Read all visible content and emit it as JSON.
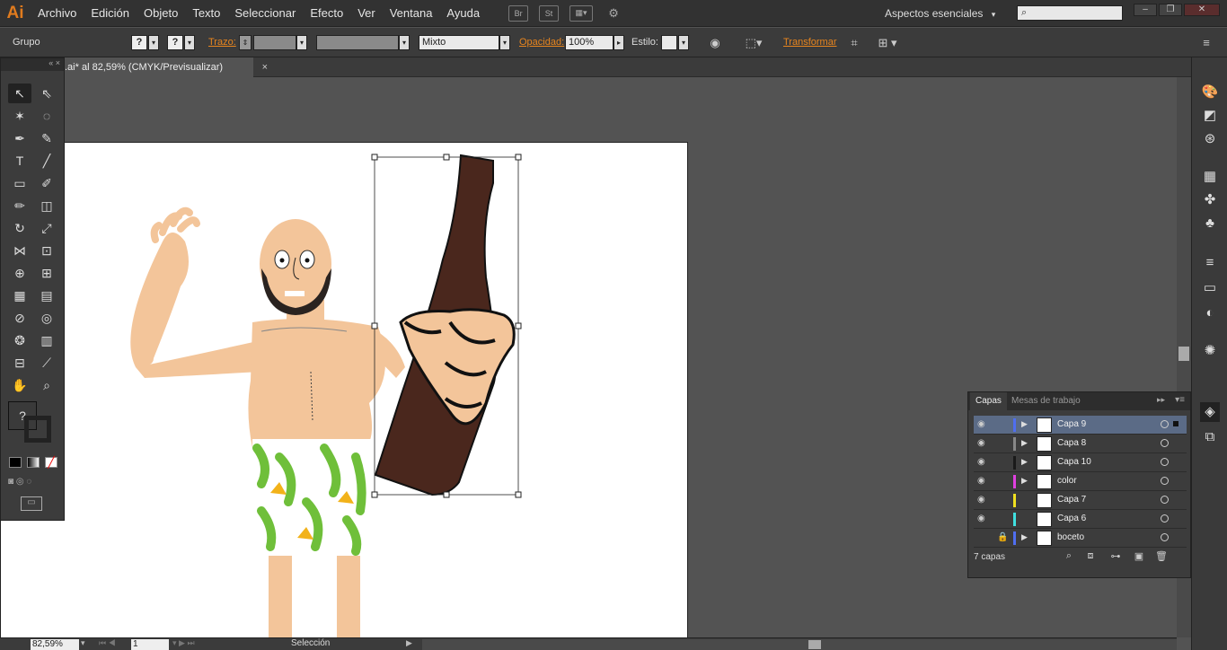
{
  "app": {
    "logo": "Ai"
  },
  "menu": [
    "Archivo",
    "Edición",
    "Objeto",
    "Texto",
    "Seleccionar",
    "Efecto",
    "Ver",
    "Ventana",
    "Ayuda"
  ],
  "menubar_icons": {
    "br": "Br",
    "st": "St"
  },
  "workspace": {
    "label": "Aspectos esenciales",
    "chevron": "▾"
  },
  "control": {
    "group_label": "Grupo",
    "stroke_label": "Trazo:",
    "mode_value": "Mixto",
    "opacity_label": "Opacidad:",
    "opacity_value": "100%",
    "style_label": "Estilo:",
    "transform_label": "Transformar"
  },
  "document": {
    "tab_title": ".ai* al 82,59% (CMYK/Previsualizar)",
    "close": "×"
  },
  "tools_panel": {
    "unknown_glyph": "?"
  },
  "layers_panel": {
    "tab_layers": "Capas",
    "tab_artboards": "Mesas de trabajo",
    "count": "7 capas",
    "layers": [
      {
        "name": "Capa 9",
        "color": "#4f6ef0",
        "visible": true,
        "expandable": true,
        "locked": false,
        "selected": true
      },
      {
        "name": "Capa 8",
        "color": "#888888",
        "visible": true,
        "expandable": true,
        "locked": false,
        "selected": false
      },
      {
        "name": "Capa 10",
        "color": "#1a1a1a",
        "visible": true,
        "expandable": true,
        "locked": false,
        "selected": false
      },
      {
        "name": "color",
        "color": "#e040e0",
        "visible": true,
        "expandable": true,
        "locked": false,
        "selected": false
      },
      {
        "name": "Capa 7",
        "color": "#f0e020",
        "visible": true,
        "expandable": false,
        "locked": false,
        "selected": false
      },
      {
        "name": "Capa 6",
        "color": "#40e0e0",
        "visible": true,
        "expandable": false,
        "locked": false,
        "selected": false
      },
      {
        "name": "boceto",
        "color": "#4f6ef0",
        "visible": false,
        "expandable": true,
        "locked": true,
        "selected": false
      }
    ]
  },
  "status": {
    "zoom": "82,59%",
    "page": "1",
    "mode": "Selección"
  }
}
